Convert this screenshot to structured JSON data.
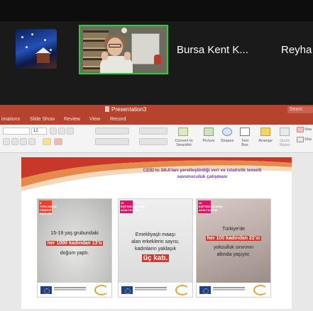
{
  "zoom": {
    "participants": [
      {
        "name": "Bursa Kent K..."
      },
      {
        "name": "Reyha"
      }
    ]
  },
  "powerpoint": {
    "window_title": "Presentation3",
    "search_placeholder": "Searc",
    "menu": [
      "imations",
      "Slide Show",
      "Review",
      "View",
      "Record"
    ],
    "font_size": "12",
    "ribbon_buttons": {
      "convert_smartart": "Convert to SmartArt",
      "picture": "Picture",
      "shapes": "Shapes",
      "text_box": "Text Box",
      "arrange": "Arrange",
      "quick_styles": "Quick Styles",
      "shape": "Sha",
      "shape2": "Sha"
    }
  },
  "slide": {
    "heading_line1": "CEİD’in SKA’ları yerelleştirdiği veri ve istatistik temelli",
    "heading_line2": "savunuculuk çalışması",
    "cards": [
      {
        "sdg": "5 TOPLUMSAL CİNSİYET EŞİTLİĞİ",
        "line1": "15-19 yaş grubundaki",
        "highlight": "her 1000 kadından 13'ü",
        "line3": "doğum yaptı."
      },
      {
        "sdg": "10 EŞİTSİZLİKLERİN AZALTILMASI",
        "line1": "Emekliyaşlı maaşı",
        "line2": "alan erkeklerin sayısı,",
        "line3": "kadınların yaklaşık",
        "highlight": "üç katı."
      },
      {
        "sdg": "10 EŞİTSİZLİKLERİN AZALTILMASI",
        "line1": "Türkiye'de",
        "highlight": "her 100 kadından 22'si",
        "line3": "yoksulluk sınırının",
        "line4": "altında yaşıyor."
      }
    ]
  },
  "colors": {
    "ppt_accent": "#b5432d",
    "zoom_active_border": "#2ecc40",
    "slide_heading": "#6a3fb0",
    "highlight_red": "#d23a2e"
  }
}
